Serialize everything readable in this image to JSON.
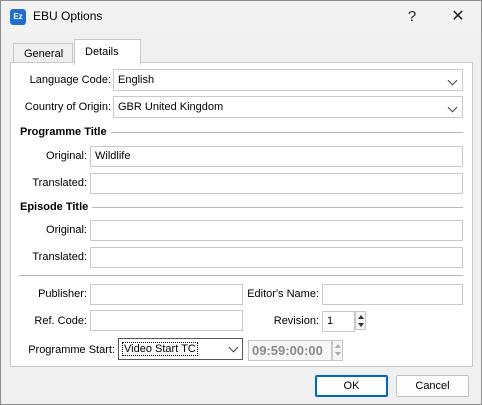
{
  "window": {
    "icon_text": "Ez",
    "title": "EBU Options",
    "help_glyph": "?",
    "close_glyph": "✕"
  },
  "tabs": [
    {
      "label": "General",
      "selected": false
    },
    {
      "label": "Details",
      "selected": true
    }
  ],
  "details": {
    "language_code": {
      "label": "Language Code:",
      "value": "English"
    },
    "country_of_origin": {
      "label": "Country of Origin:",
      "value": "GBR United Kingdom"
    },
    "programme_title": {
      "heading": "Programme Title",
      "original_label": "Original:",
      "original_value": "Wildlife",
      "translated_label": "Translated:",
      "translated_value": ""
    },
    "episode_title": {
      "heading": "Episode Title",
      "original_label": "Original:",
      "original_value": "",
      "translated_label": "Translated:",
      "translated_value": ""
    },
    "publisher": {
      "label": "Publisher:",
      "value": ""
    },
    "editors_name": {
      "label": "Editor's Name:",
      "value": ""
    },
    "ref_code": {
      "label": "Ref. Code:",
      "value": ""
    },
    "revision": {
      "label": "Revision:",
      "value": "1"
    },
    "programme_start": {
      "label": "Programme Start:",
      "value": "Video Start TC",
      "timecode": "09:59:00:00"
    }
  },
  "buttons": {
    "ok": "OK",
    "cancel": "Cancel"
  }
}
